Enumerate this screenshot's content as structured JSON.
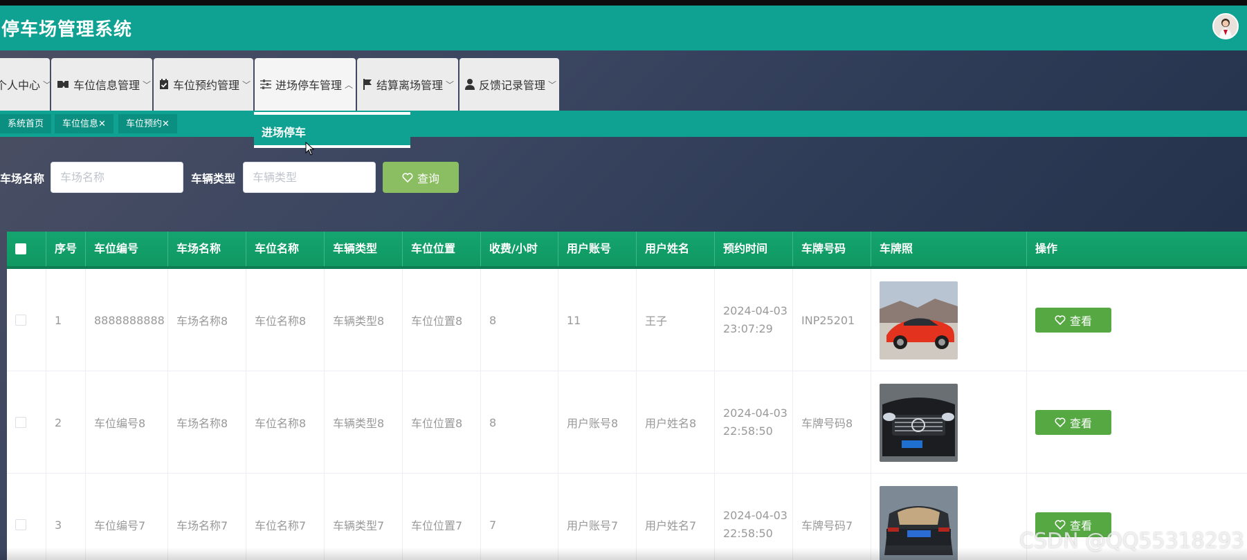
{
  "header": {
    "title": "停车场管理系统",
    "avatar_icon": "user-avatar"
  },
  "nav": {
    "items": [
      {
        "label": "个人中心",
        "icon": "user-icon"
      },
      {
        "label": "车位信息管理",
        "icon": "ticket-icon"
      },
      {
        "label": "车位预约管理",
        "icon": "calendar-check-icon"
      },
      {
        "label": "进场停车管理",
        "icon": "sliders-icon"
      },
      {
        "label": "结算离场管理",
        "icon": "flag-icon"
      },
      {
        "label": "反馈记录管理",
        "icon": "user-solid-icon"
      }
    ],
    "dropdown_item": "进场停车"
  },
  "tags": [
    {
      "label": "系统首页"
    },
    {
      "label": "车位信息✕"
    },
    {
      "label": "车位预约✕"
    }
  ],
  "search": {
    "field1_label": "车场名称",
    "field1_placeholder": "车场名称",
    "field2_label": "车辆类型",
    "field2_placeholder": "车辆类型",
    "button_label": "查询"
  },
  "table": {
    "headers": [
      "序号",
      "车位编号",
      "车场名称",
      "车位名称",
      "车辆类型",
      "车位位置",
      "收费/小时",
      "用户账号",
      "用户姓名",
      "预约时间",
      "车牌号码",
      "车牌照",
      "操作"
    ],
    "rows": [
      {
        "no": "1",
        "code": "8888888888",
        "lot": "车场名称8",
        "space": "车位名称8",
        "type": "车辆类型8",
        "pos": "车位位置8",
        "fee": "8",
        "account": "11",
        "name": "王子",
        "date": "2024-04-03",
        "time": "23:07:29",
        "plate": "INP25201",
        "action": "查看"
      },
      {
        "no": "2",
        "code": "车位编号8",
        "lot": "车场名称8",
        "space": "车位名称8",
        "type": "车辆类型8",
        "pos": "车位位置8",
        "fee": "8",
        "account": "用户账号8",
        "name": "用户姓名8",
        "date": "2024-04-03",
        "time": "22:58:50",
        "plate": "车牌号码8",
        "action": "查看"
      },
      {
        "no": "3",
        "code": "车位编号7",
        "lot": "车场名称7",
        "space": "车位名称7",
        "type": "车辆类型7",
        "pos": "车位位置7",
        "fee": "7",
        "account": "用户账号7",
        "name": "用户姓名7",
        "date": "2024-04-03",
        "time": "22:58:50",
        "plate": "车牌号码7",
        "action": "查看"
      }
    ]
  },
  "watermark": "CSDN @QQ55318293",
  "colors": {
    "primary": "#0fa192",
    "table_head": "#14a46f",
    "view_button": "#56a843",
    "search_button": "#8bbd62"
  }
}
